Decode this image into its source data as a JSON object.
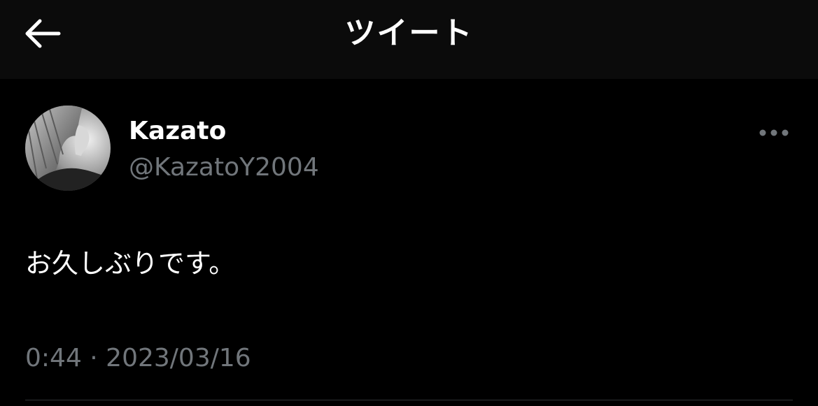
{
  "header": {
    "back_icon": "arrow-left-icon",
    "title": "ツイート"
  },
  "tweet": {
    "author": {
      "display_name": "Kazato",
      "handle": "@KazatoY2004",
      "avatar": "profile-photo"
    },
    "more_icon": "more-dots-icon",
    "text": "お久しぶりです。",
    "timestamp": "0:44 · 2023/03/16"
  },
  "colors": {
    "background": "#000000",
    "header_background": "#0b0b0b",
    "primary_text": "#ffffff",
    "secondary_text": "#71767b",
    "divider": "#2f3336"
  }
}
